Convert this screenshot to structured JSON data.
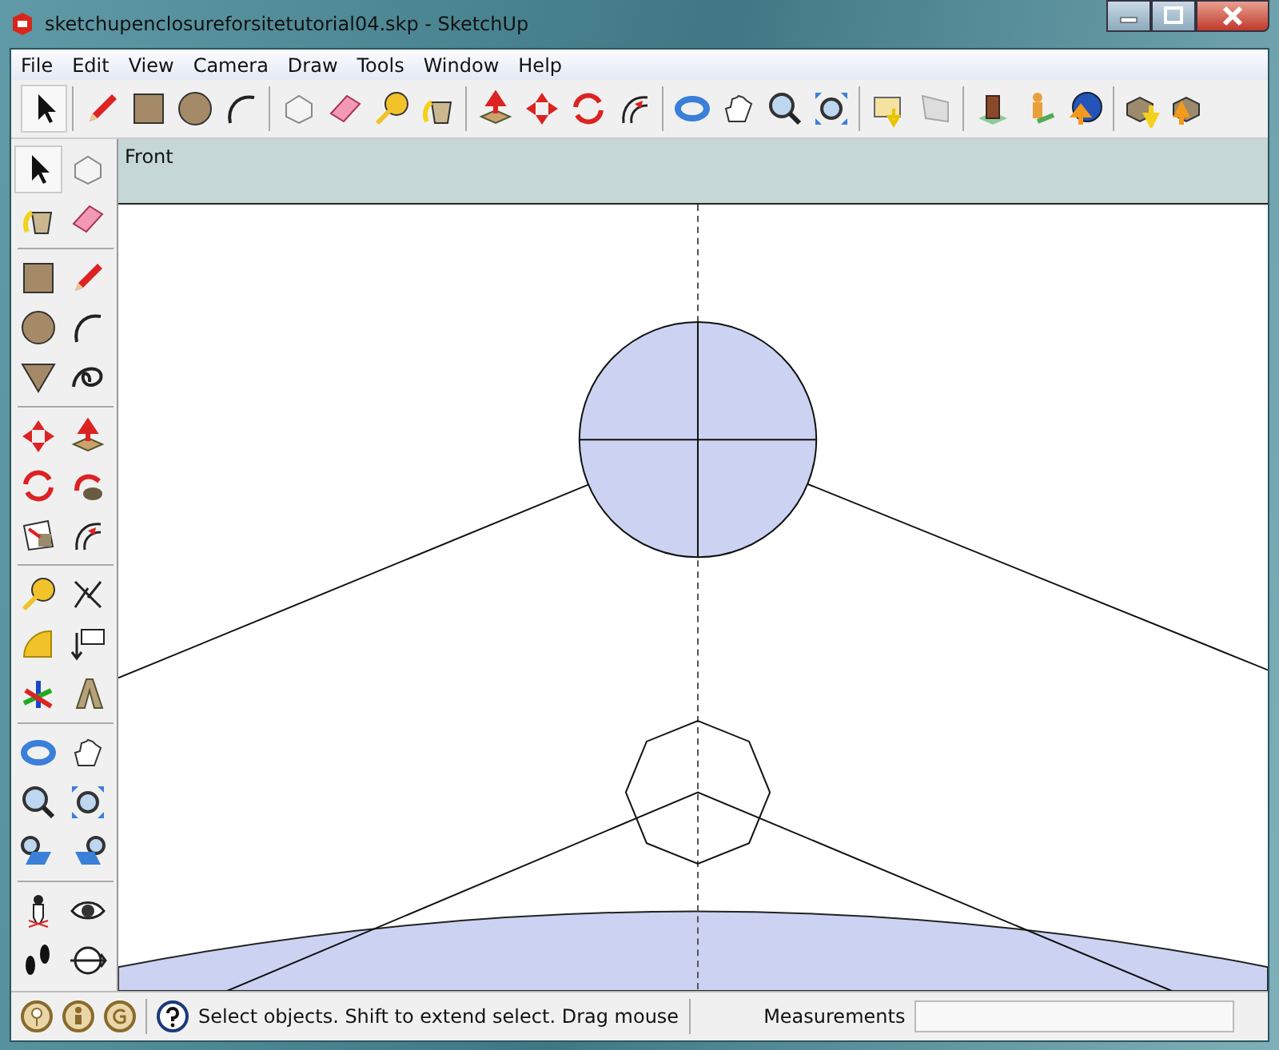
{
  "window": {
    "title": "sketchupenclosureforsitetutorial04.skp - SketchUp"
  },
  "menu": [
    "File",
    "Edit",
    "View",
    "Camera",
    "Draw",
    "Tools",
    "Window",
    "Help"
  ],
  "top_toolbar": [
    {
      "tools": [
        {
          "kind": "select",
          "selected": true
        }
      ]
    },
    {
      "tools": [
        {
          "kind": "pencil",
          "selected": false
        },
        {
          "kind": "rectangle",
          "selected": false
        },
        {
          "kind": "circle",
          "selected": false
        },
        {
          "kind": "arc",
          "selected": false
        }
      ]
    },
    {
      "tools": [
        {
          "kind": "component",
          "selected": false
        },
        {
          "kind": "eraser",
          "selected": false
        },
        {
          "kind": "tape",
          "selected": false
        },
        {
          "kind": "paint",
          "selected": false
        }
      ]
    },
    {
      "tools": [
        {
          "kind": "pushpull",
          "selected": false
        },
        {
          "kind": "move",
          "selected": false
        },
        {
          "kind": "rotate",
          "selected": false
        },
        {
          "kind": "offset",
          "selected": false
        }
      ]
    },
    {
      "tools": [
        {
          "kind": "orbit",
          "selected": false
        },
        {
          "kind": "pan",
          "selected": false
        },
        {
          "kind": "zoom",
          "selected": false
        },
        {
          "kind": "zoomext",
          "selected": false
        }
      ]
    },
    {
      "tools": [
        {
          "kind": "docdown",
          "selected": false
        },
        {
          "kind": "sheet",
          "selected": false
        }
      ]
    },
    {
      "tools": [
        {
          "kind": "building",
          "selected": false
        },
        {
          "kind": "person",
          "selected": false
        },
        {
          "kind": "globe",
          "selected": false
        }
      ]
    },
    {
      "tools": [
        {
          "kind": "boxdown",
          "selected": false
        },
        {
          "kind": "boxup",
          "selected": false
        }
      ]
    }
  ],
  "left_toolbar": [
    {
      "tools": [
        {
          "kind": "select",
          "selected": true
        },
        {
          "kind": "component",
          "selected": false
        },
        {
          "kind": "paint",
          "selected": false
        },
        {
          "kind": "eraser",
          "selected": false
        }
      ]
    },
    {
      "tools": [
        {
          "kind": "rectangle",
          "selected": false
        },
        {
          "kind": "pencil",
          "selected": false
        },
        {
          "kind": "circle",
          "selected": false
        },
        {
          "kind": "arc",
          "selected": false
        },
        {
          "kind": "polygon",
          "selected": false
        },
        {
          "kind": "freehand",
          "selected": false
        }
      ]
    },
    {
      "tools": [
        {
          "kind": "move",
          "selected": false
        },
        {
          "kind": "pushpull",
          "selected": false
        },
        {
          "kind": "rotate",
          "selected": false
        },
        {
          "kind": "followme",
          "selected": false
        },
        {
          "kind": "scale",
          "selected": false
        },
        {
          "kind": "offset",
          "selected": false
        }
      ]
    },
    {
      "tools": [
        {
          "kind": "tape",
          "selected": false
        },
        {
          "kind": "dimension",
          "selected": false
        },
        {
          "kind": "protractor",
          "selected": false
        },
        {
          "kind": "text",
          "selected": false
        },
        {
          "kind": "axes",
          "selected": false
        },
        {
          "kind": "text3d",
          "selected": false
        }
      ]
    },
    {
      "tools": [
        {
          "kind": "orbit",
          "selected": false
        },
        {
          "kind": "pan",
          "selected": false
        },
        {
          "kind": "zoom",
          "selected": false
        },
        {
          "kind": "zoomext",
          "selected": false
        },
        {
          "kind": "prev",
          "selected": false
        },
        {
          "kind": "next",
          "selected": false
        }
      ]
    },
    {
      "tools": [
        {
          "kind": "position",
          "selected": false
        },
        {
          "kind": "look",
          "selected": false
        },
        {
          "kind": "walk",
          "selected": false
        },
        {
          "kind": "section",
          "selected": false
        }
      ]
    }
  ],
  "viewport": {
    "view_label": "Front"
  },
  "status_bar": {
    "message": "Select objects. Shift to extend select. Drag mouse",
    "measurements_label": "Measurements"
  }
}
